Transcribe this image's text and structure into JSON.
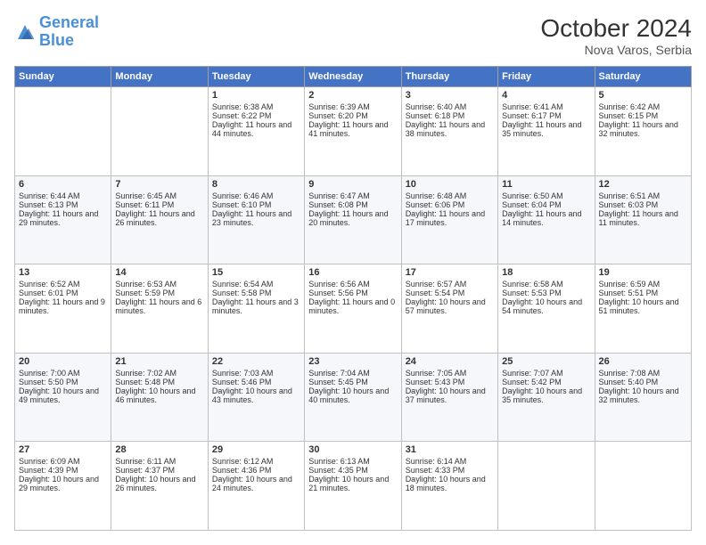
{
  "header": {
    "logo_line1": "General",
    "logo_line2": "Blue",
    "month": "October 2024",
    "location": "Nova Varos, Serbia"
  },
  "days_of_week": [
    "Sunday",
    "Monday",
    "Tuesday",
    "Wednesday",
    "Thursday",
    "Friday",
    "Saturday"
  ],
  "weeks": [
    [
      {
        "day": "",
        "sunrise": "",
        "sunset": "",
        "daylight": ""
      },
      {
        "day": "",
        "sunrise": "",
        "sunset": "",
        "daylight": ""
      },
      {
        "day": "1",
        "sunrise": "Sunrise: 6:38 AM",
        "sunset": "Sunset: 6:22 PM",
        "daylight": "Daylight: 11 hours and 44 minutes."
      },
      {
        "day": "2",
        "sunrise": "Sunrise: 6:39 AM",
        "sunset": "Sunset: 6:20 PM",
        "daylight": "Daylight: 11 hours and 41 minutes."
      },
      {
        "day": "3",
        "sunrise": "Sunrise: 6:40 AM",
        "sunset": "Sunset: 6:18 PM",
        "daylight": "Daylight: 11 hours and 38 minutes."
      },
      {
        "day": "4",
        "sunrise": "Sunrise: 6:41 AM",
        "sunset": "Sunset: 6:17 PM",
        "daylight": "Daylight: 11 hours and 35 minutes."
      },
      {
        "day": "5",
        "sunrise": "Sunrise: 6:42 AM",
        "sunset": "Sunset: 6:15 PM",
        "daylight": "Daylight: 11 hours and 32 minutes."
      }
    ],
    [
      {
        "day": "6",
        "sunrise": "Sunrise: 6:44 AM",
        "sunset": "Sunset: 6:13 PM",
        "daylight": "Daylight: 11 hours and 29 minutes."
      },
      {
        "day": "7",
        "sunrise": "Sunrise: 6:45 AM",
        "sunset": "Sunset: 6:11 PM",
        "daylight": "Daylight: 11 hours and 26 minutes."
      },
      {
        "day": "8",
        "sunrise": "Sunrise: 6:46 AM",
        "sunset": "Sunset: 6:10 PM",
        "daylight": "Daylight: 11 hours and 23 minutes."
      },
      {
        "day": "9",
        "sunrise": "Sunrise: 6:47 AM",
        "sunset": "Sunset: 6:08 PM",
        "daylight": "Daylight: 11 hours and 20 minutes."
      },
      {
        "day": "10",
        "sunrise": "Sunrise: 6:48 AM",
        "sunset": "Sunset: 6:06 PM",
        "daylight": "Daylight: 11 hours and 17 minutes."
      },
      {
        "day": "11",
        "sunrise": "Sunrise: 6:50 AM",
        "sunset": "Sunset: 6:04 PM",
        "daylight": "Daylight: 11 hours and 14 minutes."
      },
      {
        "day": "12",
        "sunrise": "Sunrise: 6:51 AM",
        "sunset": "Sunset: 6:03 PM",
        "daylight": "Daylight: 11 hours and 11 minutes."
      }
    ],
    [
      {
        "day": "13",
        "sunrise": "Sunrise: 6:52 AM",
        "sunset": "Sunset: 6:01 PM",
        "daylight": "Daylight: 11 hours and 9 minutes."
      },
      {
        "day": "14",
        "sunrise": "Sunrise: 6:53 AM",
        "sunset": "Sunset: 5:59 PM",
        "daylight": "Daylight: 11 hours and 6 minutes."
      },
      {
        "day": "15",
        "sunrise": "Sunrise: 6:54 AM",
        "sunset": "Sunset: 5:58 PM",
        "daylight": "Daylight: 11 hours and 3 minutes."
      },
      {
        "day": "16",
        "sunrise": "Sunrise: 6:56 AM",
        "sunset": "Sunset: 5:56 PM",
        "daylight": "Daylight: 11 hours and 0 minutes."
      },
      {
        "day": "17",
        "sunrise": "Sunrise: 6:57 AM",
        "sunset": "Sunset: 5:54 PM",
        "daylight": "Daylight: 10 hours and 57 minutes."
      },
      {
        "day": "18",
        "sunrise": "Sunrise: 6:58 AM",
        "sunset": "Sunset: 5:53 PM",
        "daylight": "Daylight: 10 hours and 54 minutes."
      },
      {
        "day": "19",
        "sunrise": "Sunrise: 6:59 AM",
        "sunset": "Sunset: 5:51 PM",
        "daylight": "Daylight: 10 hours and 51 minutes."
      }
    ],
    [
      {
        "day": "20",
        "sunrise": "Sunrise: 7:00 AM",
        "sunset": "Sunset: 5:50 PM",
        "daylight": "Daylight: 10 hours and 49 minutes."
      },
      {
        "day": "21",
        "sunrise": "Sunrise: 7:02 AM",
        "sunset": "Sunset: 5:48 PM",
        "daylight": "Daylight: 10 hours and 46 minutes."
      },
      {
        "day": "22",
        "sunrise": "Sunrise: 7:03 AM",
        "sunset": "Sunset: 5:46 PM",
        "daylight": "Daylight: 10 hours and 43 minutes."
      },
      {
        "day": "23",
        "sunrise": "Sunrise: 7:04 AM",
        "sunset": "Sunset: 5:45 PM",
        "daylight": "Daylight: 10 hours and 40 minutes."
      },
      {
        "day": "24",
        "sunrise": "Sunrise: 7:05 AM",
        "sunset": "Sunset: 5:43 PM",
        "daylight": "Daylight: 10 hours and 37 minutes."
      },
      {
        "day": "25",
        "sunrise": "Sunrise: 7:07 AM",
        "sunset": "Sunset: 5:42 PM",
        "daylight": "Daylight: 10 hours and 35 minutes."
      },
      {
        "day": "26",
        "sunrise": "Sunrise: 7:08 AM",
        "sunset": "Sunset: 5:40 PM",
        "daylight": "Daylight: 10 hours and 32 minutes."
      }
    ],
    [
      {
        "day": "27",
        "sunrise": "Sunrise: 6:09 AM",
        "sunset": "Sunset: 4:39 PM",
        "daylight": "Daylight: 10 hours and 29 minutes."
      },
      {
        "day": "28",
        "sunrise": "Sunrise: 6:11 AM",
        "sunset": "Sunset: 4:37 PM",
        "daylight": "Daylight: 10 hours and 26 minutes."
      },
      {
        "day": "29",
        "sunrise": "Sunrise: 6:12 AM",
        "sunset": "Sunset: 4:36 PM",
        "daylight": "Daylight: 10 hours and 24 minutes."
      },
      {
        "day": "30",
        "sunrise": "Sunrise: 6:13 AM",
        "sunset": "Sunset: 4:35 PM",
        "daylight": "Daylight: 10 hours and 21 minutes."
      },
      {
        "day": "31",
        "sunrise": "Sunrise: 6:14 AM",
        "sunset": "Sunset: 4:33 PM",
        "daylight": "Daylight: 10 hours and 18 minutes."
      },
      {
        "day": "",
        "sunrise": "",
        "sunset": "",
        "daylight": ""
      },
      {
        "day": "",
        "sunrise": "",
        "sunset": "",
        "daylight": ""
      }
    ]
  ]
}
